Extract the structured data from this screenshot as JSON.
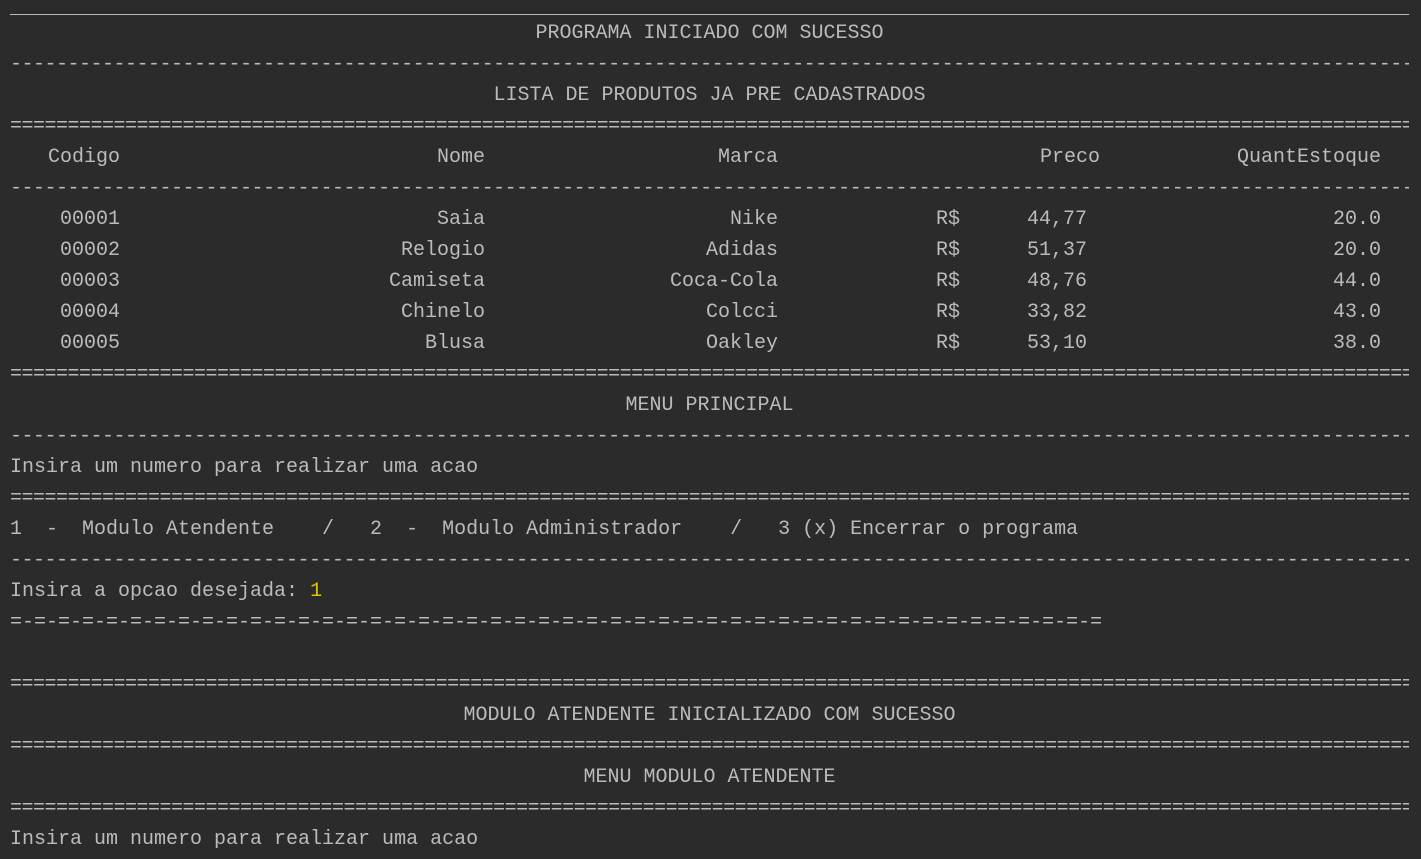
{
  "header": {
    "title": "PROGRAMA INICIADO COM SUCESSO",
    "dash_line": "------------------------------------------------------------------------------------------------------------------------------------------------------------------------------------------------",
    "list_title": "LISTA DE PRODUTOS JA PRE CADASTRADOS",
    "eq_line": "================================================================================================================================================================================================"
  },
  "table": {
    "columns": [
      "Codigo",
      "Nome",
      "Marca",
      "Preco",
      "QuantEstoque"
    ],
    "currency": "R$",
    "rows": [
      {
        "codigo": "00001",
        "nome": "Saia",
        "marca": "Nike",
        "preco": "44,77",
        "quant": "20.0"
      },
      {
        "codigo": "00002",
        "nome": "Relogio",
        "marca": "Adidas",
        "preco": "51,37",
        "quant": "20.0"
      },
      {
        "codigo": "00003",
        "nome": "Camiseta",
        "marca": "Coca-Cola",
        "preco": "48,76",
        "quant": "44.0"
      },
      {
        "codigo": "00004",
        "nome": "Chinelo",
        "marca": "Colcci",
        "preco": "33,82",
        "quant": "43.0"
      },
      {
        "codigo": "00005",
        "nome": "Blusa",
        "marca": "Oakley",
        "preco": "53,10",
        "quant": "38.0"
      }
    ]
  },
  "menu_principal": {
    "title": "MENU PRINCIPAL",
    "prompt": "Insira um numero para realizar uma acao",
    "options": "1  -  Modulo Atendente    /   2  -  Modulo Administrador    /   3 (x) Encerrar o programa",
    "input_label": "Insira a opcao desejada: ",
    "input_value": "1",
    "mixed_line": "=-=-=-=-=-=-=-=-=-=-=-=-=-=-=-=-=-=-=-=-=-=-=-=-=-=-=-=-=-=-=-=-=-=-=-=-=-=-=-=-=-=-=-=-=-="
  },
  "modulo_atendente": {
    "status": "MODULO ATENDENTE INICIALIZADO COM SUCESSO",
    "menu_title": "MENU MODULO ATENDENTE",
    "prompt": "Insira um numero para realizar uma acao"
  },
  "colors": {
    "background": "#2b2b2b",
    "text": "#bbbbbb",
    "user_input": "#e5c100"
  }
}
